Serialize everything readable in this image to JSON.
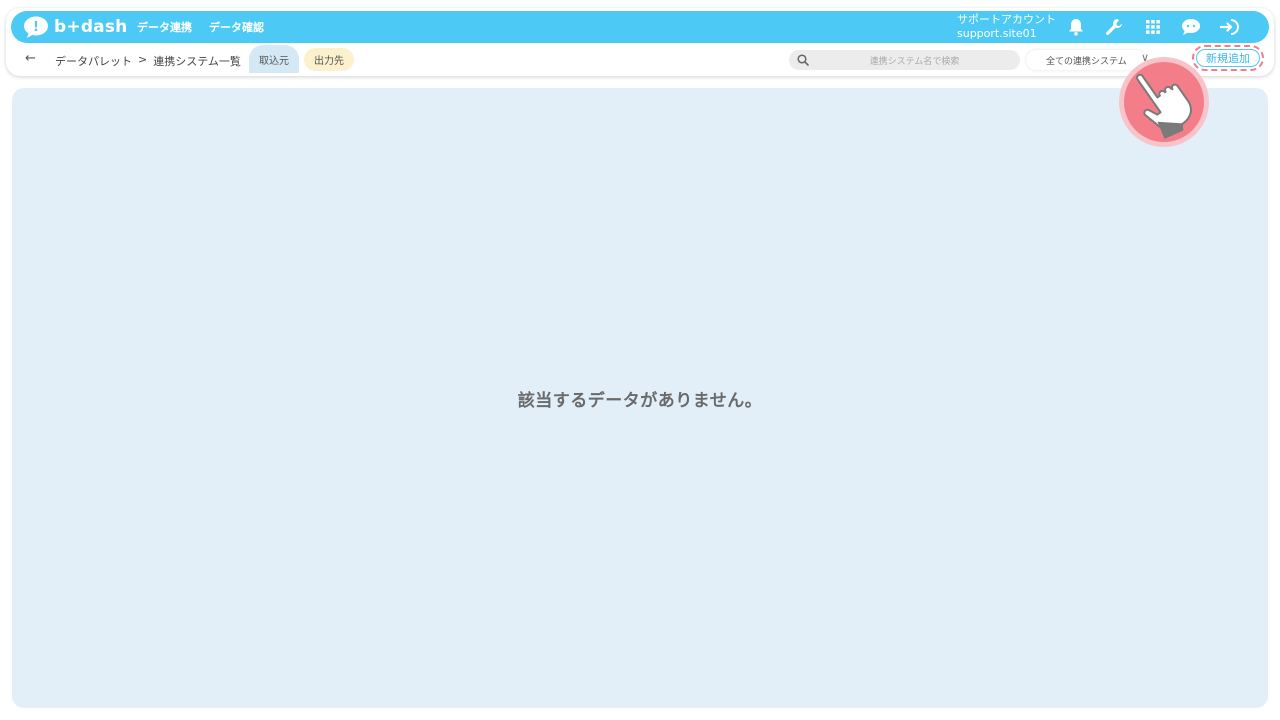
{
  "header": {
    "logo_text": "b+dash",
    "nav": [
      {
        "label": "データ連携"
      },
      {
        "label": "データ確認"
      }
    ],
    "account_name": "サポートアカウント",
    "account_site": "support.site01",
    "icons": [
      "bell-icon",
      "wrench-icon",
      "grid-icon",
      "chat-icon",
      "logout-icon"
    ]
  },
  "subbar": {
    "back_icon": "←",
    "breadcrumb": {
      "first": "データパレット",
      "separator": ">",
      "second": "連携システム一覧"
    },
    "tabs": [
      {
        "label": "取込元"
      },
      {
        "label": "出力先"
      }
    ],
    "search_placeholder": "連携システム名で検索",
    "filter_value": "全ての連携システム",
    "filter_chevron": "∨",
    "add_button": "新規追加"
  },
  "main": {
    "empty_message": "該当するデータがありません。"
  },
  "colors": {
    "brand": "#4ccaf5",
    "panel": "#e2eef8",
    "highlight": "#f27d8a"
  }
}
